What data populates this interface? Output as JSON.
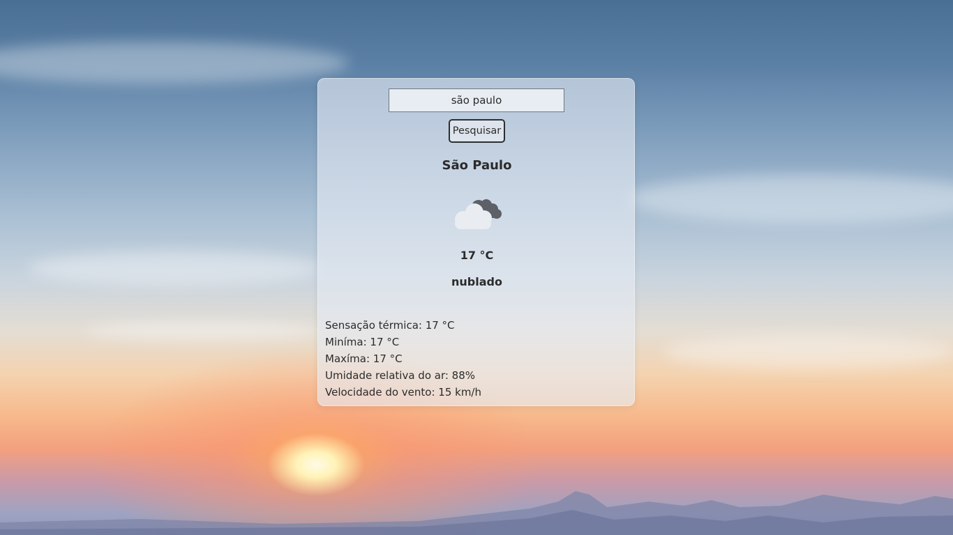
{
  "search": {
    "value": "são paulo",
    "button_label": "Pesquisar"
  },
  "weather": {
    "city": "São Paulo",
    "icon": "cloudy-icon",
    "temperature": "17 °C",
    "description": "nublado",
    "details": {
      "feels_like": "Sensação térmica: 17 °C",
      "min": "Miníma: 17 °C",
      "max": "Maxíma: 17 °C",
      "humidity": "Umidade relativa do ar: 88%",
      "wind": "Velocidade do vento: 15 km/h"
    }
  }
}
